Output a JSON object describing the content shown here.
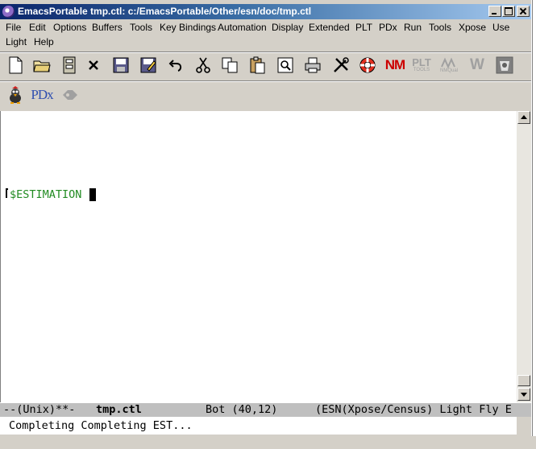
{
  "window": {
    "title": "EmacsPortable tmp.ctl: c:/EmacsPortable/Other/esn/doc/tmp.ctl"
  },
  "menu": {
    "row1": [
      "File",
      "Edit",
      "Options",
      "Buffers",
      "Tools",
      "Key Bindings",
      "Automation",
      "Display",
      "Extended",
      "PLT",
      "PDx",
      "Run",
      "Tools",
      "Xpose",
      "Use"
    ],
    "row2": [
      "Light",
      "Help"
    ]
  },
  "toolbar": {
    "icons": [
      "new-file-icon",
      "open-folder-icon",
      "file-cabinet-icon",
      "close-x-icon",
      "save-icon",
      "save-as-icon",
      "undo-icon",
      "cut-icon",
      "copy-icon",
      "paste-icon",
      "search-icon",
      "print-icon",
      "tools-icon",
      "help-lifebuoy-icon",
      "nm-icon",
      "plt-tools-icon",
      "nmqual-icon",
      "w-icon",
      "xpose-icon"
    ],
    "nm_label": "NM",
    "plt_label": "PLT",
    "plt_sub": "TOOLS",
    "w_label": "W",
    "nmqual_label": "NMQual",
    "row2_icons": [
      "esn-bird-icon",
      "pdx-icon",
      "census-icon"
    ],
    "pdx_label": "PDx"
  },
  "editor": {
    "line": "$ESTIMATION"
  },
  "modeline": {
    "status": "--(Unix)**-",
    "buffer": "tmp.ctl",
    "position": "Bot (40,12)",
    "modes": "(ESN(Xpose/Census) Light Fly E"
  },
  "minibuffer": {
    "text": "Completing Completing EST..."
  },
  "colors": {
    "keyword": "#228b22",
    "nm_red": "#cc0000",
    "titlebar": "#0a246a"
  }
}
